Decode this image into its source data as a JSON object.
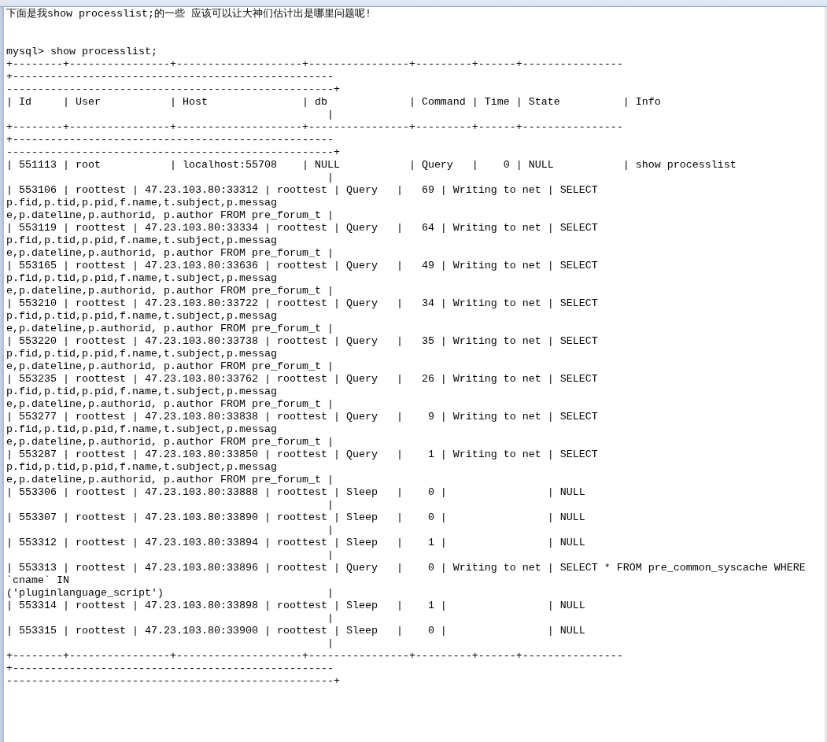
{
  "intro": "下面是我show processlist;的一些 应该可以让大神们估计出是哪里问题呢!",
  "prompt": "mysql> show processlist;",
  "output_lines": [
    "+--------+----------------+--------------------+----------------+---------+------+----------------",
    "+---------------------------------------------------",
    "----------------------------------------------------+",
    "| Id     | User           | Host               | db             | Command | Time | State          | Info",
    "                                                   |",
    "+--------+----------------+--------------------+----------------+---------+------+----------------",
    "+---------------------------------------------------",
    "----------------------------------------------------+",
    "| 551113 | root           | localhost:55708    | NULL           | Query   |    0 | NULL           | show processlist",
    "                                                   |",
    "| 553106 | roottest | 47.23.103.80:33312 | roottest | Query   |   69 | Writing to net | SELECT",
    "p.fid,p.tid,p.pid,f.name,t.subject,p.messag",
    "e,p.dateline,p.authorid, p.author FROM pre_forum_t |",
    "| 553119 | roottest | 47.23.103.80:33334 | roottest | Query   |   64 | Writing to net | SELECT",
    "p.fid,p.tid,p.pid,f.name,t.subject,p.messag",
    "e,p.dateline,p.authorid, p.author FROM pre_forum_t |",
    "| 553165 | roottest | 47.23.103.80:33636 | roottest | Query   |   49 | Writing to net | SELECT",
    "p.fid,p.tid,p.pid,f.name,t.subject,p.messag",
    "e,p.dateline,p.authorid, p.author FROM pre_forum_t |",
    "| 553210 | roottest | 47.23.103.80:33722 | roottest | Query   |   34 | Writing to net | SELECT",
    "p.fid,p.tid,p.pid,f.name,t.subject,p.messag",
    "e,p.dateline,p.authorid, p.author FROM pre_forum_t |",
    "| 553220 | roottest | 47.23.103.80:33738 | roottest | Query   |   35 | Writing to net | SELECT",
    "p.fid,p.tid,p.pid,f.name,t.subject,p.messag",
    "e,p.dateline,p.authorid, p.author FROM pre_forum_t |",
    "| 553235 | roottest | 47.23.103.80:33762 | roottest | Query   |   26 | Writing to net | SELECT",
    "p.fid,p.tid,p.pid,f.name,t.subject,p.messag",
    "e,p.dateline,p.authorid, p.author FROM pre_forum_t |",
    "| 553277 | roottest | 47.23.103.80:33838 | roottest | Query   |    9 | Writing to net | SELECT",
    "p.fid,p.tid,p.pid,f.name,t.subject,p.messag",
    "e,p.dateline,p.authorid, p.author FROM pre_forum_t |",
    "| 553287 | roottest | 47.23.103.80:33850 | roottest | Query   |    1 | Writing to net | SELECT",
    "p.fid,p.tid,p.pid,f.name,t.subject,p.messag",
    "e,p.dateline,p.authorid, p.author FROM pre_forum_t |",
    "| 553306 | roottest | 47.23.103.80:33888 | roottest | Sleep   |    0 |                | NULL",
    "                                                   |",
    "| 553307 | roottest | 47.23.103.80:33890 | roottest | Sleep   |    0 |                | NULL",
    "                                                   |",
    "| 553312 | roottest | 47.23.103.80:33894 | roottest | Sleep   |    1 |                | NULL",
    "                                                   |",
    "| 553313 | roottest | 47.23.103.80:33896 | roottest | Query   |    0 | Writing to net | SELECT * FROM pre_common_syscache WHERE",
    "`cname` IN",
    "('pluginlanguage_script')                          |",
    "| 553314 | roottest | 47.23.103.80:33898 | roottest | Sleep   |    1 |                | NULL",
    "                                                   |",
    "| 553315 | roottest | 47.23.103.80:33900 | roottest | Sleep   |    0 |                | NULL",
    "                                                   |",
    "+--------+----------------+--------------------+----------------+---------+------+----------------",
    "+---------------------------------------------------",
    "----------------------------------------------------+"
  ]
}
